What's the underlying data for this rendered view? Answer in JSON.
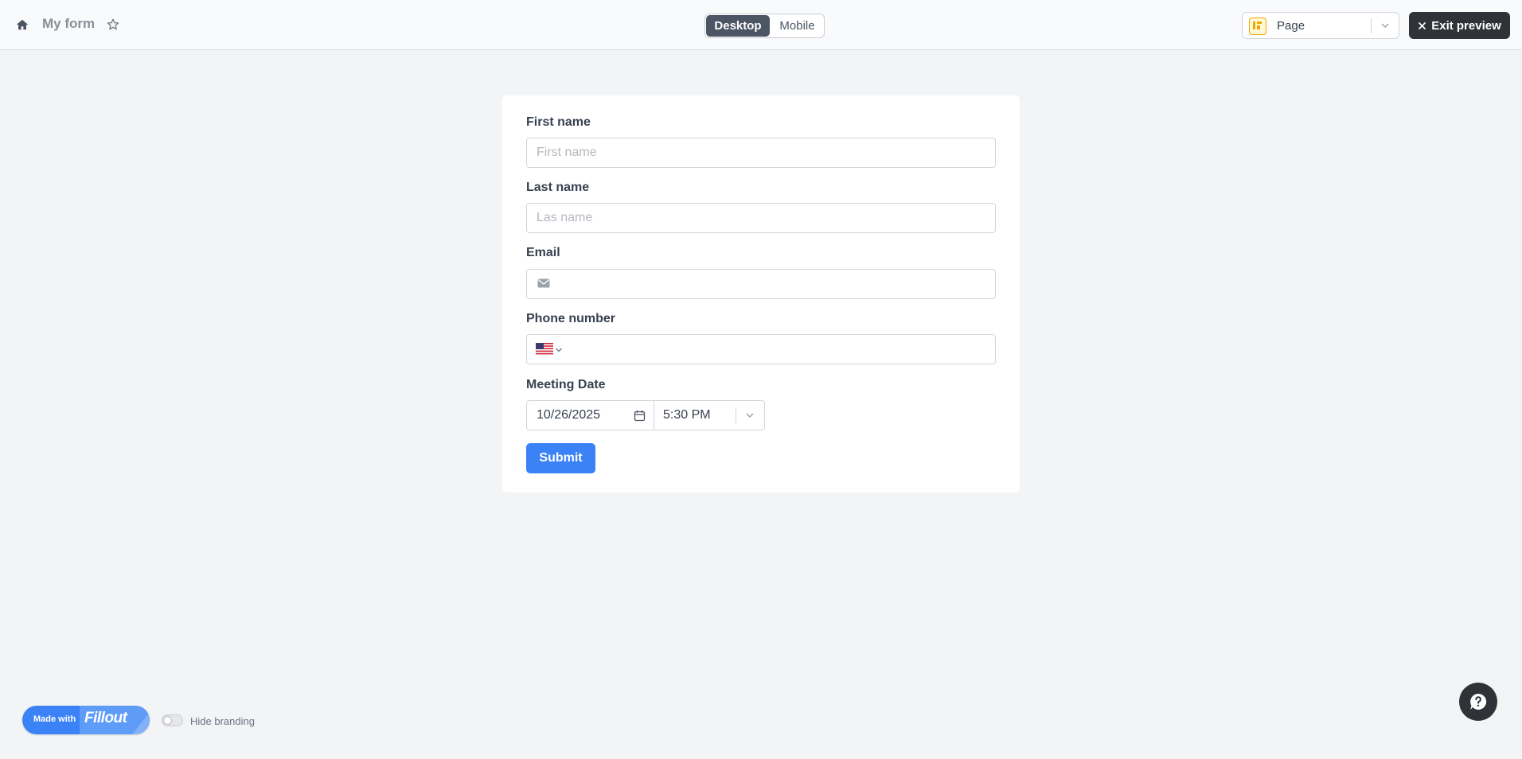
{
  "header": {
    "form_title": "My form",
    "view_tabs": [
      {
        "label": "Desktop",
        "active": true
      },
      {
        "label": "Mobile",
        "active": false
      }
    ],
    "page_select": {
      "value": "Page"
    },
    "exit_label": "Exit preview"
  },
  "form": {
    "fields": {
      "first_name": {
        "label": "First name",
        "placeholder": "First name",
        "value": ""
      },
      "last_name": {
        "label": "Last name",
        "placeholder": "Las name",
        "value": ""
      },
      "email": {
        "label": "Email",
        "placeholder": "",
        "value": ""
      },
      "phone": {
        "label": "Phone number",
        "value": "",
        "country_icon": "us-flag-icon"
      },
      "meeting_date": {
        "label": "Meeting Date",
        "date": "10/26/2025",
        "time": "5:30 PM"
      }
    },
    "submit_label": "Submit"
  },
  "footer": {
    "made_with": "Made with",
    "brand": "Fillout",
    "hide_branding_label": "Hide branding",
    "hide_branding_on": false
  },
  "colors": {
    "accent": "#3b82f6",
    "dark": "#2f3337",
    "background": "#f3f4f6"
  }
}
